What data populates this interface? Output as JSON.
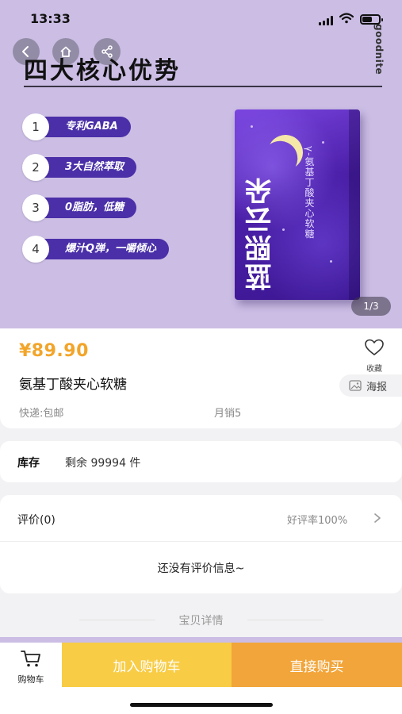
{
  "status_bar": {
    "time": "13:33"
  },
  "hero": {
    "brand": "goodnite",
    "headline": "四大核心优势",
    "features": [
      {
        "num": "1",
        "text": "专利GABA"
      },
      {
        "num": "2",
        "text": "3大自然萃取"
      },
      {
        "num": "3",
        "text": "0脂肪，低糖"
      },
      {
        "num": "4",
        "text": "爆汁Q弹，一嚼倾心"
      }
    ],
    "package": {
      "name": "蓝熙云朵",
      "subtitle": "γ-氨基丁酸夹心软糖"
    },
    "pager": "1/3",
    "accent_color": "#4a2fa8",
    "background_color": "#cbbde4"
  },
  "product": {
    "price": "¥89.90",
    "title": "氨基丁酸夹心软糖",
    "favorite_label": "收藏",
    "poster_label": "海报",
    "shipping": "快递:包邮",
    "monthly_sales": "月销5",
    "price_color": "#f2a52a"
  },
  "stock": {
    "label": "库存",
    "value": "剩余 99994 件"
  },
  "reviews": {
    "label": "评价(0)",
    "rate": "好评率100%",
    "empty_text": "还没有评价信息~"
  },
  "details": {
    "title": "宝贝详情"
  },
  "bottom_bar": {
    "cart_label": "购物车",
    "add_to_cart": "加入购物车",
    "buy_now": "直接购买",
    "add_color": "#f8cc45",
    "buy_color": "#f2a53a"
  },
  "icons": [
    "back-icon",
    "home-icon",
    "share-icon",
    "heart-icon",
    "image-icon",
    "chevron-right-icon",
    "cart-icon",
    "signal-icon",
    "wifi-icon",
    "battery-icon"
  ]
}
